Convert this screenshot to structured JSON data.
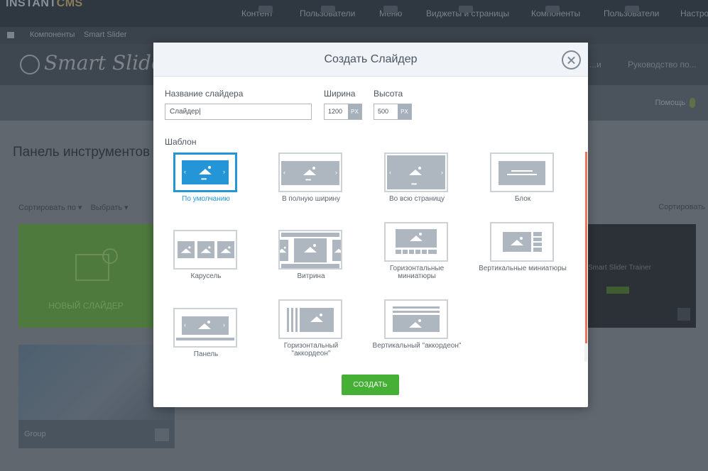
{
  "background": {
    "app_logo": "INSTANTCMS",
    "top_nav": [
      "Контент",
      "Пользователи",
      "Меню",
      "Виджеты и страницы",
      "Компоненты",
      "Пользователи",
      "Настройки"
    ],
    "breadcrumbs": [
      "Компоненты",
      "Smart Slider"
    ],
    "smart_slider_logo": "Smart Slider",
    "ss_nav": [
      "...и",
      "Руководство по..."
    ],
    "help_label": "Помощь",
    "dashboard_title": "Панель инструментов",
    "filters": [
      "Сортировать по ▾",
      "Выбрать ▾"
    ],
    "sort_label": "Сортировать",
    "new_slider_card": "НОВЫЙ СЛАЙДЕР",
    "dark_card_text": "Smart Slider Trainer",
    "group_card_label": "Group"
  },
  "modal": {
    "title": "Создать Слайдер",
    "name_label": "Название слайдера",
    "name_value": "Слайдер|",
    "width_label": "Ширина",
    "width_value": "1200",
    "height_label": "Высота",
    "height_value": "500",
    "unit": "PX",
    "template_label": "Шаблон",
    "templates": [
      {
        "label": "По умолчанию",
        "selected": true
      },
      {
        "label": "В полную ширину"
      },
      {
        "label": "Во всю страницу"
      },
      {
        "label": "Блок"
      },
      {
        "label": "Карусель"
      },
      {
        "label": "Витрина"
      },
      {
        "label": "Горизонтальные миниатюры"
      },
      {
        "label": "Вертикальные миниатюры"
      },
      {
        "label": "Панель"
      },
      {
        "label": "Горизонтальный \"аккордеон\""
      },
      {
        "label": "Вертикальный \"аккордеон\""
      }
    ],
    "create_button": "СОЗДАТЬ"
  },
  "colors": {
    "accent_blue": "#2496d8",
    "create_green": "#45b035",
    "scroll_accent": "#e8775c"
  }
}
